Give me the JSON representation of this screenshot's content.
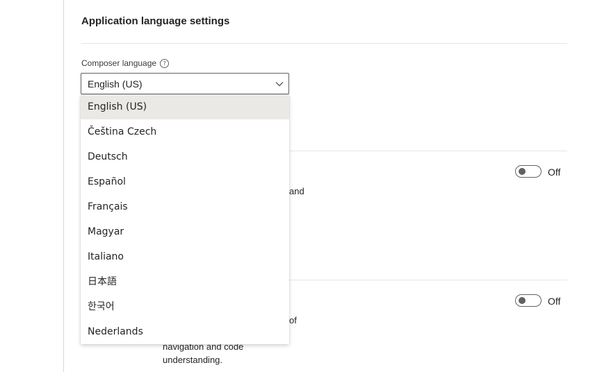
{
  "section": {
    "title": "Application language settings"
  },
  "composer_language": {
    "label": "Composer language",
    "help_icon": "?",
    "selected_value": "English (US)",
    "options": [
      "English (US)",
      "Čeština Czech",
      "Deutsch",
      "Español",
      "Français",
      "Magyar",
      "Italiano",
      "日本語",
      "한국어",
      "Nederlands"
    ]
  },
  "setting_1": {
    "partial_text": "and",
    "toggle_state": "Off"
  },
  "setting_2": {
    "partial_text_line1": "of",
    "partial_text_line2": "navigation and code",
    "partial_text_line3": "understanding.",
    "toggle_state": "Off"
  },
  "colors": {
    "selected_option_bg": "#ebe9e6",
    "border": "#616161"
  }
}
